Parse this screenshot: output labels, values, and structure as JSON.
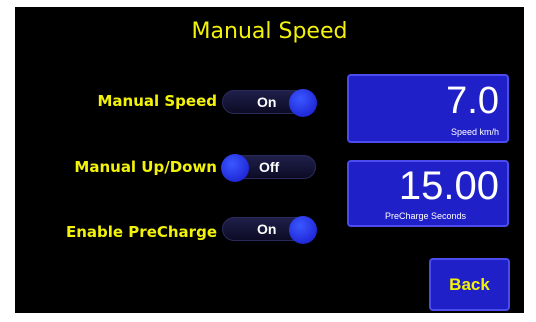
{
  "title": "Manual Speed",
  "settings": [
    {
      "label": "Manual Speed",
      "state": "On"
    },
    {
      "label": "Manual Up/Down",
      "state": "Off"
    },
    {
      "label": "Enable PreCharge",
      "state": "On"
    }
  ],
  "speed": {
    "value": "7.0",
    "unit": "Speed km/h"
  },
  "precharge": {
    "value": "15.00",
    "unit": "PreCharge Seconds"
  },
  "back_label": "Back",
  "colors": {
    "background": "#000000",
    "text": "#f2f20a",
    "button": "#2020c8",
    "knob": "#1f3cff"
  }
}
